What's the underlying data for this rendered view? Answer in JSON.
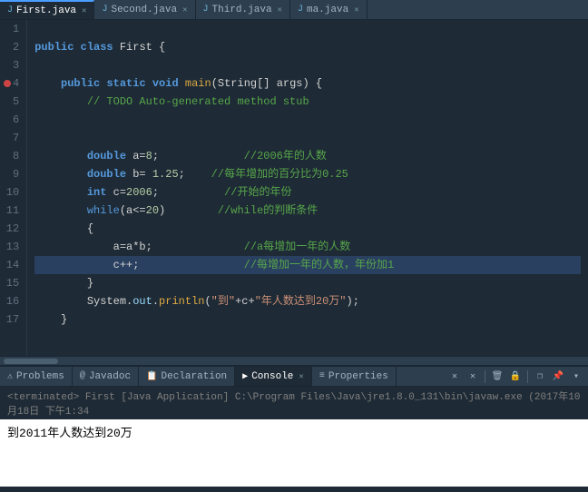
{
  "tabs": [
    {
      "label": "First.java",
      "active": true,
      "icon": "J",
      "modified": false
    },
    {
      "label": "Second.java",
      "active": false,
      "icon": "J",
      "modified": false
    },
    {
      "label": "Third.java",
      "active": false,
      "icon": "J",
      "modified": false
    },
    {
      "label": "ma.java",
      "active": false,
      "icon": "J",
      "modified": false
    }
  ],
  "editor": {
    "lines": [
      {
        "num": 1,
        "content": "",
        "highlighted": false
      },
      {
        "num": 2,
        "content": "public class First {",
        "highlighted": false
      },
      {
        "num": 3,
        "content": "",
        "highlighted": false
      },
      {
        "num": 4,
        "content": "    public static void main(String[] args) {",
        "highlighted": false,
        "breakpoint": true
      },
      {
        "num": 5,
        "content": "        // TODO Auto-generated method stub",
        "highlighted": false
      },
      {
        "num": 6,
        "content": "",
        "highlighted": false
      },
      {
        "num": 7,
        "content": "",
        "highlighted": false
      },
      {
        "num": 8,
        "content": "        double a=8;             //2006年的人数",
        "highlighted": false
      },
      {
        "num": 9,
        "content": "        double b= 1.25;    //每年增加的百分比为0.25",
        "highlighted": false
      },
      {
        "num": 10,
        "content": "        int c=2006;          //开始的年份",
        "highlighted": false
      },
      {
        "num": 11,
        "content": "        while(a<=20)        //while的判断条件",
        "highlighted": false
      },
      {
        "num": 12,
        "content": "        {",
        "highlighted": false
      },
      {
        "num": 13,
        "content": "            a=a*b;              //a每增加一年的人数",
        "highlighted": false
      },
      {
        "num": 14,
        "content": "            c++;                //每增加一年的人数，年份加1",
        "highlighted": true
      },
      {
        "num": 15,
        "content": "        }",
        "highlighted": false
      },
      {
        "num": 16,
        "content": "        System.out.println(\"到\"+c+\"年人数达到20万\");",
        "highlighted": false
      },
      {
        "num": 17,
        "content": "    }",
        "highlighted": false
      }
    ]
  },
  "bottom_tabs": [
    {
      "label": "Problems",
      "icon": "⚠",
      "active": false
    },
    {
      "label": "Javadoc",
      "icon": "@",
      "active": false
    },
    {
      "label": "Declaration",
      "icon": "D",
      "active": false
    },
    {
      "label": "Console",
      "icon": "▶",
      "active": true
    },
    {
      "label": "Properties",
      "icon": "≡",
      "active": false
    }
  ],
  "console": {
    "terminated_line": "<terminated> First [Java Application] C:\\Program Files\\Java\\jre1.8.0_131\\bin\\javaw.exe (2017年10月18日 下午1:34",
    "output": "到2011年人数达到20万"
  },
  "toolbar_buttons": [
    "✕",
    "✕",
    "⏸",
    "▶",
    "⏹",
    "⏹",
    "❐",
    "↩",
    "↪"
  ]
}
